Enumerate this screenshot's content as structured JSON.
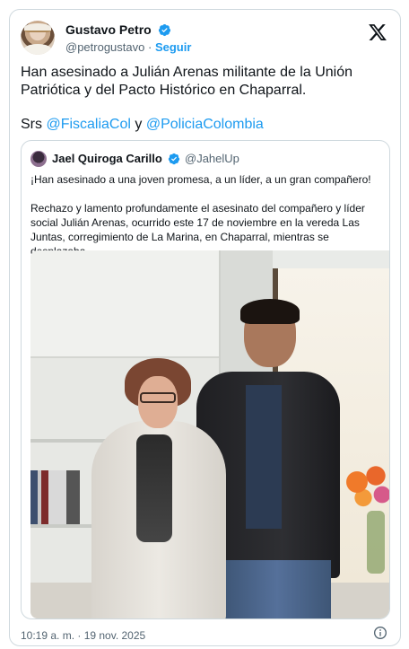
{
  "author": {
    "name": "Gustavo Petro",
    "handle": "@petrogustavo",
    "separator": "·",
    "follow_label": "Seguir"
  },
  "tweet": {
    "line1": "Han asesinado a Julián Arenas militante de la Unión Patriótica y del Pacto Histórico en Chaparral.",
    "prefix2": "Srs",
    "mention1": "@FiscaliaCol",
    "connector": "y",
    "mention2": "@PoliciaColombia"
  },
  "quoted": {
    "name": "Jael Quiroga Carillo",
    "handle": "@JahelUp",
    "paragraph1": "¡Han asesinado a una joven promesa, a un líder, a un gran compañero!",
    "paragraph2": "Rechazo y lamento profundamente el asesinato del compañero y líder social Julián Arenas, ocurrido este 17 de noviembre en la vereda Las Juntas, corregimiento de La Marina, en Chaparral, mientras se desplazaba"
  },
  "footer": {
    "timestamp": "10:19 a. m. · 19 nov. 2025"
  },
  "icons": {
    "verified": "verified-badge-icon",
    "brand": "x-logo-icon",
    "info": "info-icon"
  },
  "colors": {
    "accent": "#1d9bf0",
    "text": "#0f1419",
    "muted": "#536471",
    "border": "#cfd9de"
  }
}
